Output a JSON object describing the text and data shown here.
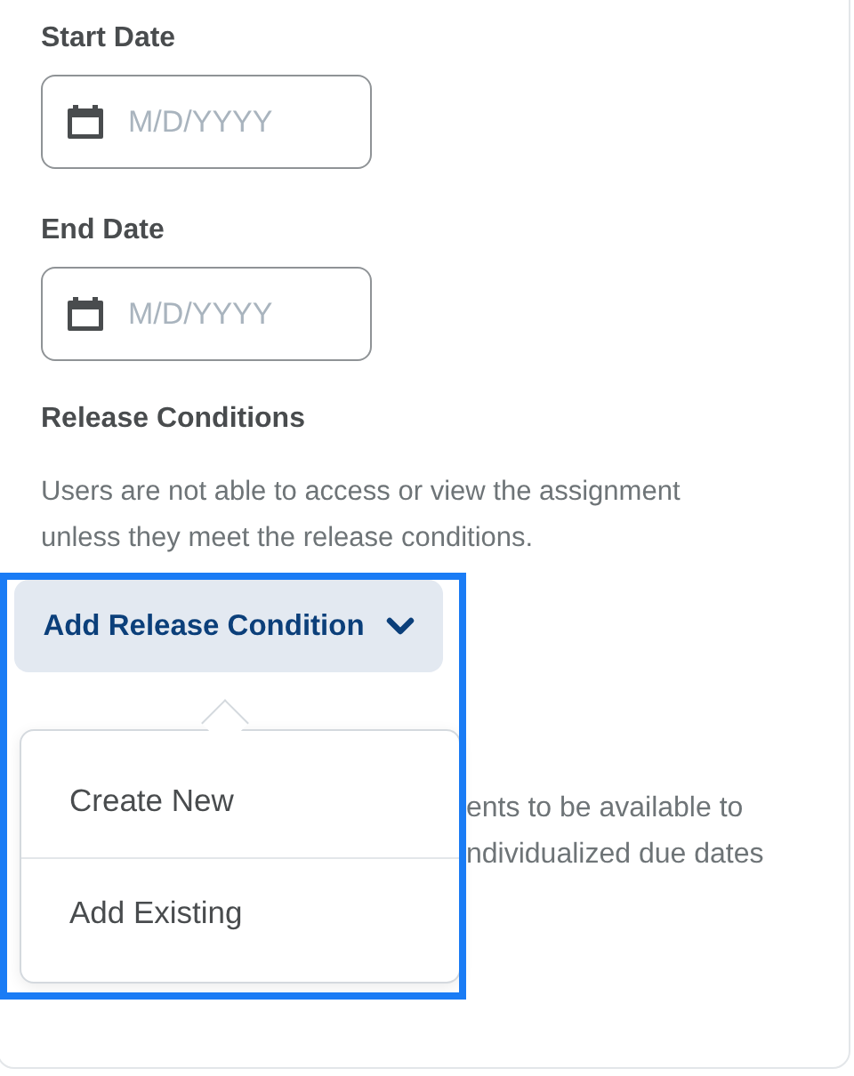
{
  "date_fields": [
    {
      "label": "Start Date",
      "placeholder": "M/D/YYYY"
    },
    {
      "label": "End Date",
      "placeholder": "M/D/YYYY"
    }
  ],
  "release_conditions": {
    "heading": "Release Conditions",
    "description": "Users are not able to access or view the assignment unless they meet the release conditions.",
    "button": "Add Release Condition"
  },
  "menu": {
    "items": [
      "Create New",
      "Add Existing"
    ]
  },
  "covered_text": [
    "ents to be available to",
    "ndividualized due dates"
  ]
}
